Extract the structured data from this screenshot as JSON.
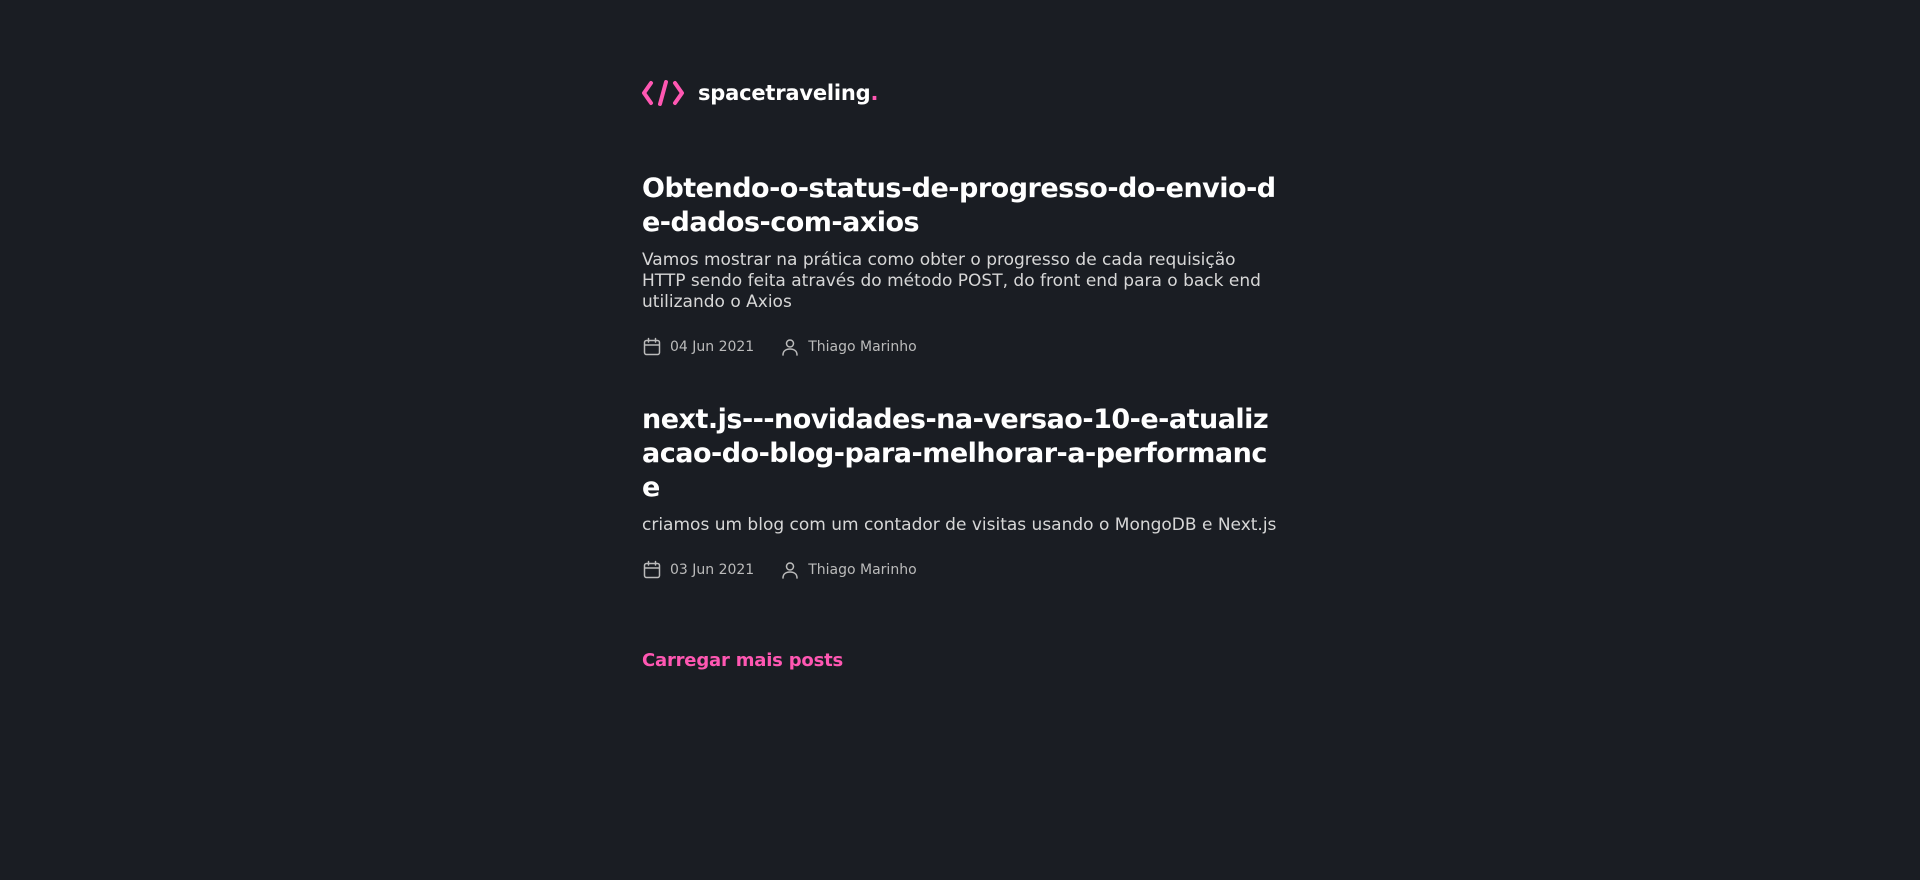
{
  "header": {
    "logo_icon": "code-brackets-icon",
    "brand_name": "spacetraveling",
    "brand_dot": ".",
    "accent_color": "#ff57b2"
  },
  "posts": [
    {
      "title": "Obtendo-o-status-de-progresso-do-envio-de-dados-com-axios",
      "subtitle": "Vamos mostrar na prática como obter o progresso de cada requisição HTTP sendo feita através do método POST, do front end para o back end utilizando o Axios",
      "date_icon": "calendar-icon",
      "date": "04 Jun 2021",
      "author_icon": "user-icon",
      "author": "Thiago Marinho"
    },
    {
      "title": "next.js---novidades-na-versao-10-e-atualizacao-do-blog-para-melhorar-a-performance",
      "subtitle": "criamos um blog com um contador de visitas usando o MongoDB e Next.js",
      "date_icon": "calendar-icon",
      "date": "03 Jun 2021",
      "author_icon": "user-icon",
      "author": "Thiago Marinho"
    }
  ],
  "load_more_label": "Carregar mais posts",
  "colors": {
    "background": "#1a1d23",
    "title": "#ffffff",
    "text": "#d7d7d7",
    "meta": "#bbbbbb",
    "accent": "#ff57b2"
  }
}
